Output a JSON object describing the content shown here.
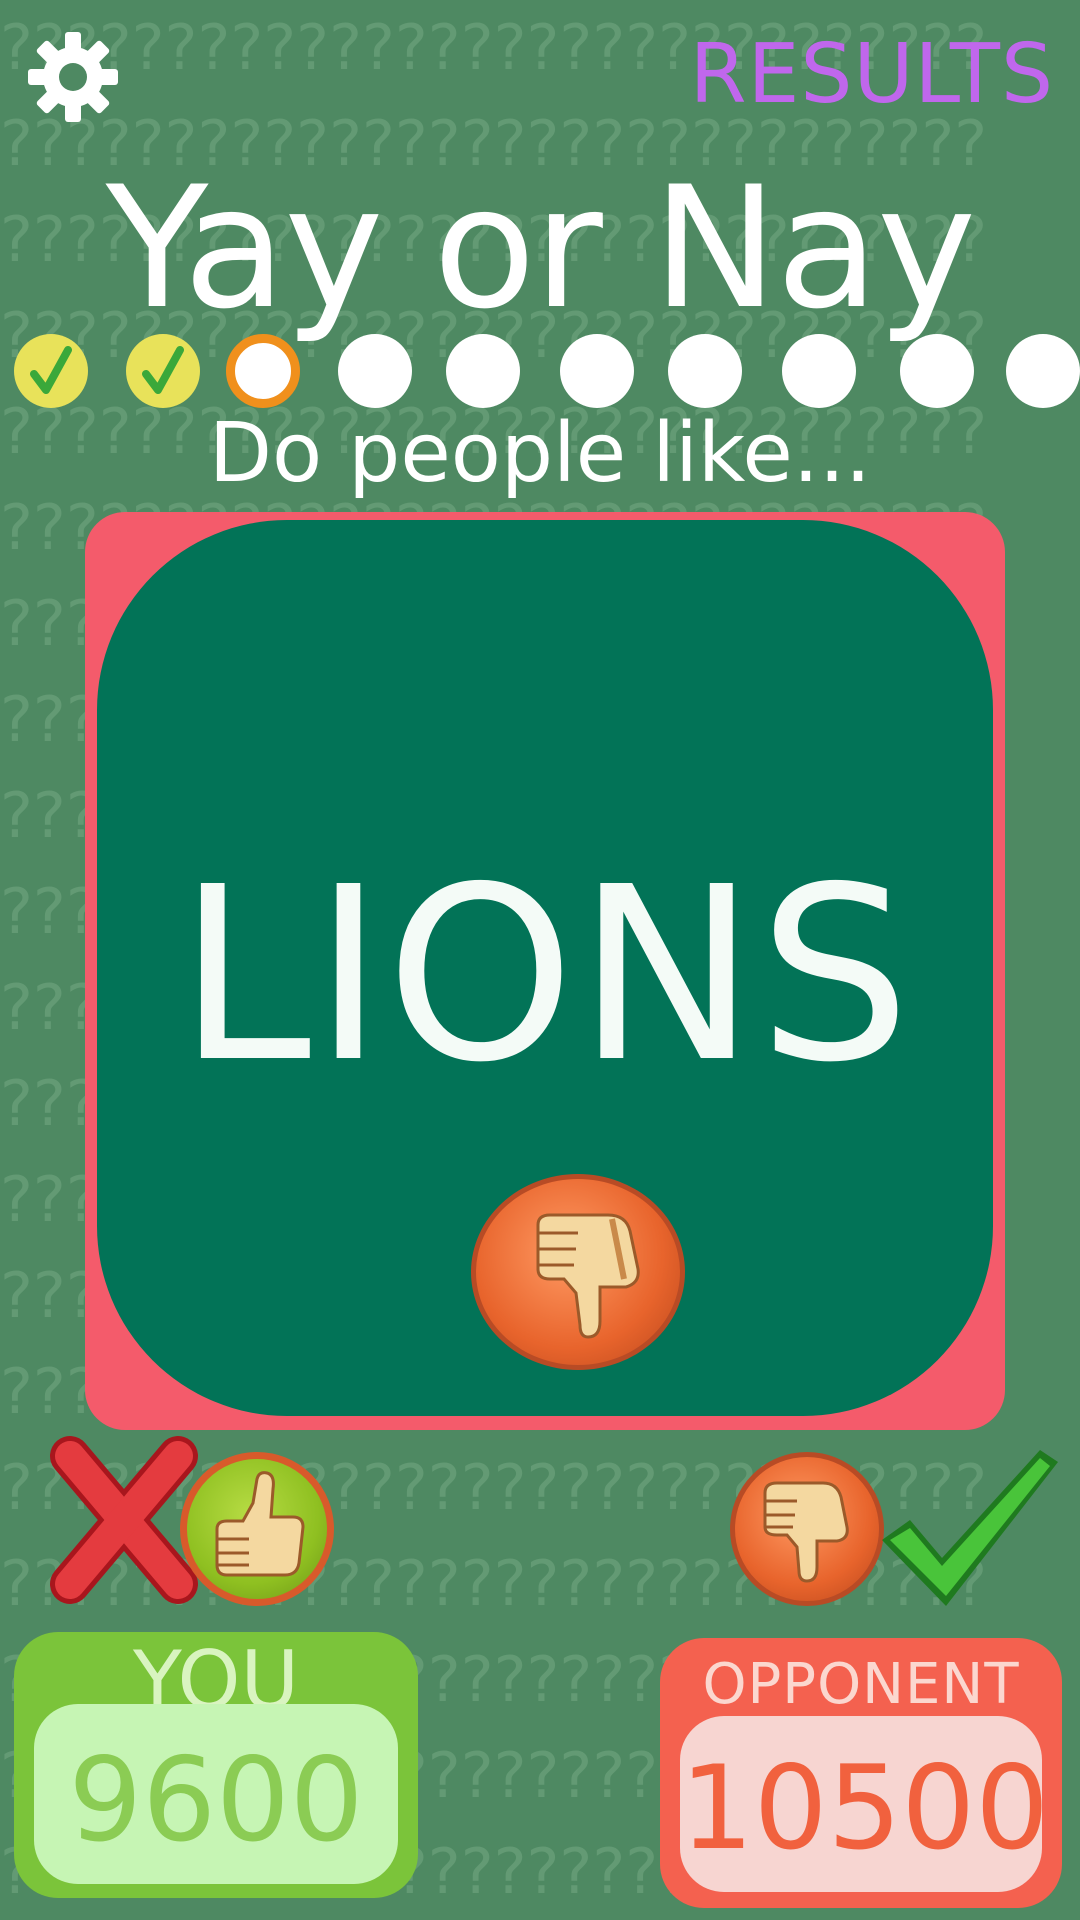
{
  "header": {
    "settings_icon": "gear-icon",
    "results_label": "RESULTS",
    "title": "Yay or Nay"
  },
  "progress": {
    "total_questions": 10,
    "current_question": 3,
    "items": [
      {
        "state": "correct",
        "icon": "check-icon"
      },
      {
        "state": "correct",
        "icon": "check-icon"
      },
      {
        "state": "current"
      },
      {
        "state": "pending"
      },
      {
        "state": "pending"
      },
      {
        "state": "pending"
      },
      {
        "state": "pending"
      },
      {
        "state": "pending"
      },
      {
        "state": "pending"
      },
      {
        "state": "pending"
      }
    ]
  },
  "question": {
    "prompt": "Do people like...",
    "subject": "LIONS",
    "answer_icon": "thumbs-down-icon"
  },
  "answers": {
    "you": {
      "choice_icon": "thumbs-up-icon",
      "result_icon": "cross-icon",
      "result": "wrong"
    },
    "opponent": {
      "choice_icon": "thumbs-down-icon",
      "result_icon": "check-icon",
      "result": "correct"
    }
  },
  "scores": {
    "you_label": "YOU",
    "you_score": "9600",
    "opponent_label": "OPPONENT",
    "opponent_score": "10500"
  },
  "colors": {
    "background": "#4e8962",
    "results_text": "#c067ec",
    "card_frame": "#f45b6b",
    "card_fill": "#027357",
    "progress_done": "#e8e25a",
    "progress_current_ring": "#f0901c",
    "you_box": "#7bc43a",
    "opponent_box": "#f4614f"
  }
}
